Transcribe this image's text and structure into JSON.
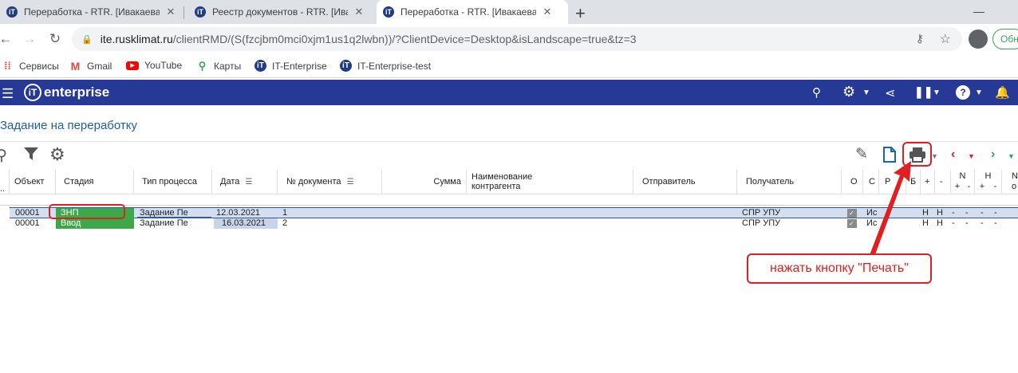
{
  "browser": {
    "tabs": [
      {
        "title": "Переработка - RTR. [Ивакаева Н",
        "active": false
      },
      {
        "title": "Реестр документов - RTR. [Ивак",
        "active": false
      },
      {
        "title": "Переработка - RTR. [Ивакаева Н",
        "active": true
      }
    ],
    "new_tab": "+",
    "url_host": "ite.rusklimat.ru",
    "url_path": "/clientRMD/(S(fzcjbm0mci0xjm1us1q2lwbn))/?ClientDevice=Desktop&isLandscape=true&tz=3",
    "profile_button": "Обн",
    "bookmarks": [
      {
        "label": "Сервисы",
        "icon": "apps-icon"
      },
      {
        "label": "Gmail",
        "icon": "gmail-icon"
      },
      {
        "label": "YouTube",
        "icon": "youtube-icon"
      },
      {
        "label": "Карты",
        "icon": "maps-icon"
      },
      {
        "label": "IT-Enterprise",
        "icon": "it-enterprise-icon"
      },
      {
        "label": "IT-Enterprise-test",
        "icon": "it-enterprise-icon"
      }
    ]
  },
  "app": {
    "logo_text": "enterprise",
    "logo_mark": "iT",
    "accent": "#263996",
    "page_title": "Задание на переработку"
  },
  "grid": {
    "columns": [
      "Объект",
      "Стадия",
      "Тип процесса",
      "Дата",
      "№ документа",
      "Сумма",
      "Наименование контрагента",
      "Отправитель",
      "Получатель",
      "О",
      "С",
      "Р",
      "Б",
      "+",
      "-",
      "N",
      "H",
      "N"
    ],
    "rows": [
      {
        "object": "00001",
        "stage": "ЗНП",
        "stage_color": "#3da847",
        "process_type": "Задание Пе",
        "date": "12.03.2021",
        "doc_number": "1",
        "sum": "",
        "counterparty": "",
        "sender": "",
        "receiver": "СПР УПУ",
        "col_c": "Ис",
        "flag1": "Н",
        "flag2": "Н",
        "dashes": [
          "-",
          "-",
          "-",
          "-"
        ]
      },
      {
        "object": "00001",
        "stage": "Ввод",
        "stage_color": "#3da847",
        "process_type": "Задание Пе",
        "date": "16.03.2021",
        "doc_number": "2",
        "sum": "",
        "counterparty": "",
        "sender": "",
        "receiver": "СПР УПУ",
        "col_c": "Ис",
        "flag1": "Н",
        "flag2": "Н",
        "dashes": [
          "-",
          "-",
          "-",
          "-"
        ]
      }
    ]
  },
  "annotation": {
    "callout_text": "нажать кнопку \"Печать\"",
    "color": "#e02020"
  }
}
